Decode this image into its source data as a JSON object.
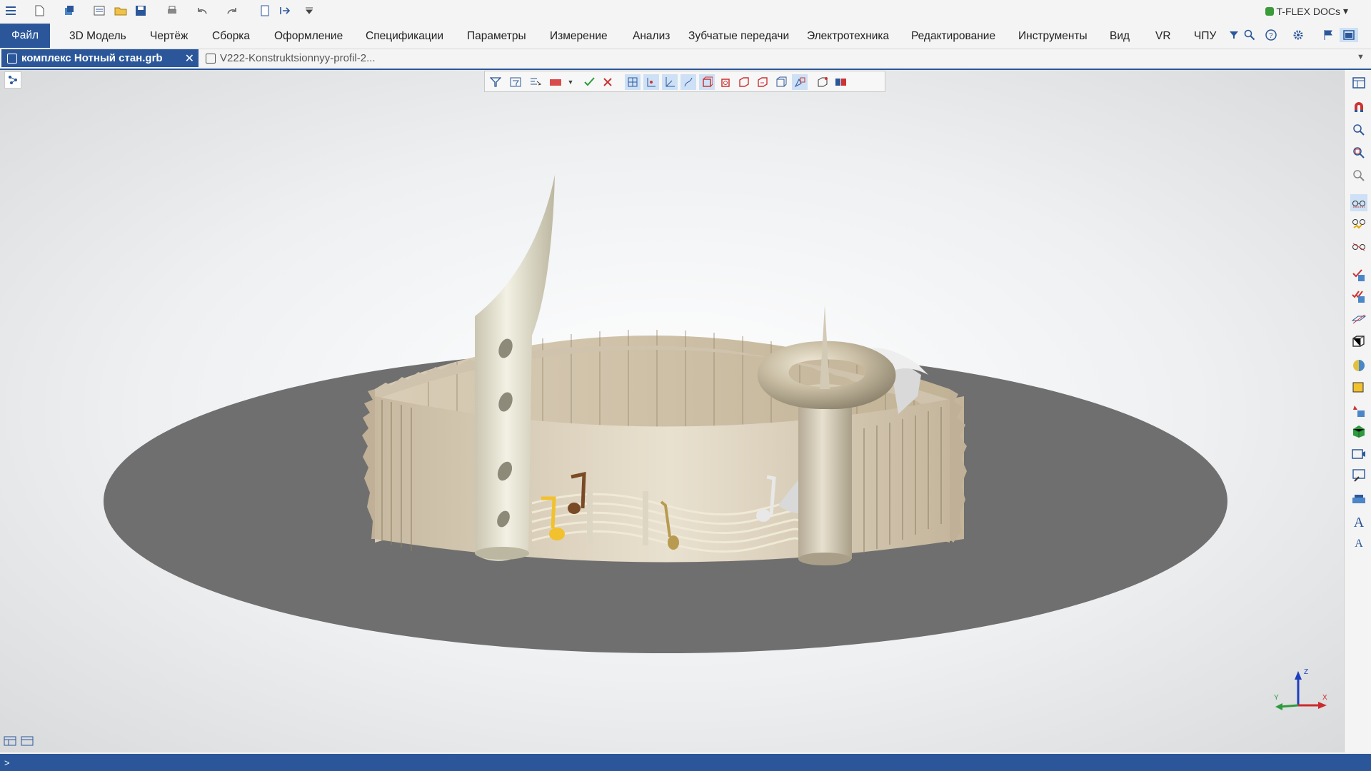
{
  "app": {
    "brand": "T-FLEX DOCs"
  },
  "menu": {
    "file": "Файл",
    "items": [
      "3D Модель",
      "Чертёж",
      "Сборка",
      "Оформление",
      "Спецификации",
      "Параметры",
      "Измерение",
      "Анализ",
      "Зубчатые передачи",
      "Электротехника",
      "Редактирование",
      "Инструменты",
      "Вид",
      "VR",
      "ЧПУ"
    ]
  },
  "tabs": [
    {
      "label": "комплекс Нотный стан.grb",
      "active": true
    },
    {
      "label": "V222-Konstruktsionnyy-profil-2...",
      "active": false
    }
  ],
  "status": {
    "prompt": ">"
  },
  "axes": {
    "x": "X",
    "y": "Y",
    "z": "Z"
  },
  "colors": {
    "accent": "#2b579a",
    "disk": "#6f6f6f",
    "panels": "#d8ccb8",
    "flute": "#e6e2d0",
    "torus": "#c9bfa8",
    "note_yellow": "#f2c12e",
    "note_brown": "#7a4a26",
    "note_gold": "#b89b50"
  }
}
